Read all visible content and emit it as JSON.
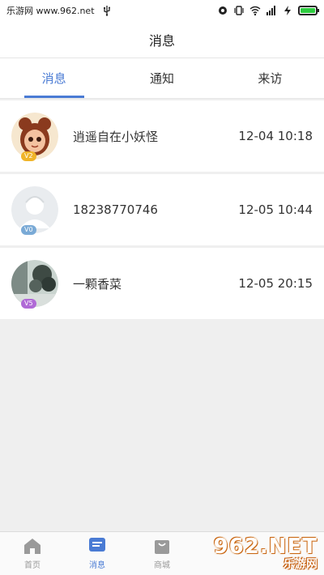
{
  "status_bar": {
    "site_label": "乐游网 www.962.net",
    "battery_color": "#2ecc40"
  },
  "header": {
    "title": "消息"
  },
  "tabs": [
    {
      "label": "消息",
      "active": true
    },
    {
      "label": "通知",
      "active": false
    },
    {
      "label": "来访",
      "active": false
    }
  ],
  "messages": [
    {
      "name": "逍遥自在小妖怪",
      "time": "12-04 10:18",
      "vip_label": "V2",
      "avatar_icon": "cartoon-girl-avatar",
      "vip_color": "#f0b429"
    },
    {
      "name": "18238770746",
      "time": "12-05 10:44",
      "vip_label": "V0",
      "avatar_icon": "default-user-avatar",
      "vip_color": "#7aaad6"
    },
    {
      "name": "一颗香菜",
      "time": "12-05 20:15",
      "vip_label": "V5",
      "avatar_icon": "plant-photo-avatar",
      "vip_color": "#b06ad6"
    }
  ],
  "bottom_nav": [
    {
      "label": "首页",
      "icon": "home-icon",
      "active": false
    },
    {
      "label": "消息",
      "icon": "message-icon",
      "active": true
    },
    {
      "label": "商城",
      "icon": "shop-bag-icon",
      "active": false
    }
  ],
  "watermark": {
    "top": "962.NET",
    "bottom": "乐游网"
  },
  "colors": {
    "accent": "#4a7bd4",
    "background": "#efefef"
  }
}
